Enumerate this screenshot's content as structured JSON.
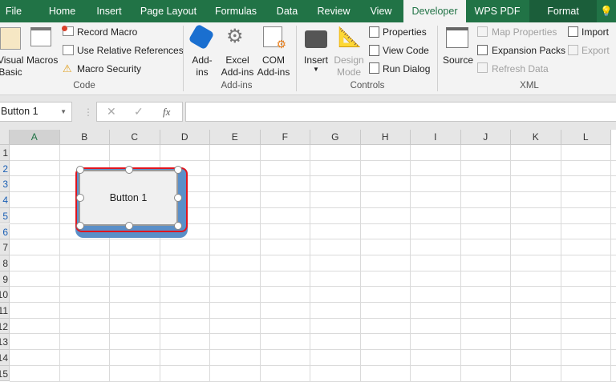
{
  "tabs": [
    "File",
    "Home",
    "Insert",
    "Page Layout",
    "Formulas",
    "Data",
    "Review",
    "View",
    "Developer",
    "WPS PDF",
    "Format"
  ],
  "active_tab": "Developer",
  "ribbon": {
    "code": {
      "label": "Code",
      "visual_basic": "Visual Basic",
      "macros": "Macros",
      "record_macro": "Record Macro",
      "use_relative": "Use Relative References",
      "macro_security": "Macro Security"
    },
    "addins": {
      "label": "Add-ins",
      "addins": "Add-ins",
      "excel_addins": "Excel Add-ins",
      "com_addins": "COM Add-ins"
    },
    "controls": {
      "label": "Controls",
      "insert": "Insert",
      "design_mode": "Design Mode",
      "properties": "Properties",
      "view_code": "View Code",
      "run_dialog": "Run Dialog"
    },
    "xml": {
      "label": "XML",
      "source": "Source",
      "map_properties": "Map Properties",
      "expansion_packs": "Expansion Packs",
      "refresh_data": "Refresh Data",
      "import": "Import",
      "export": "Export"
    }
  },
  "formula_bar": {
    "name_box": "Button 1",
    "cancel": "✕",
    "enter": "✓",
    "fx": "fx",
    "value": ""
  },
  "columns": [
    "A",
    "B",
    "C",
    "D",
    "E",
    "F",
    "G",
    "H",
    "I",
    "J",
    "K",
    "L"
  ],
  "rows": [
    "1",
    "2",
    "3",
    "4",
    "5",
    "6",
    "7",
    "8",
    "9",
    "10",
    "11",
    "12",
    "13",
    "14",
    "15"
  ],
  "button": {
    "label": "Button 1"
  },
  "colors": {
    "accent": "#217346",
    "selection": "#e0141e",
    "button_shadow": "#5a8fc8"
  }
}
